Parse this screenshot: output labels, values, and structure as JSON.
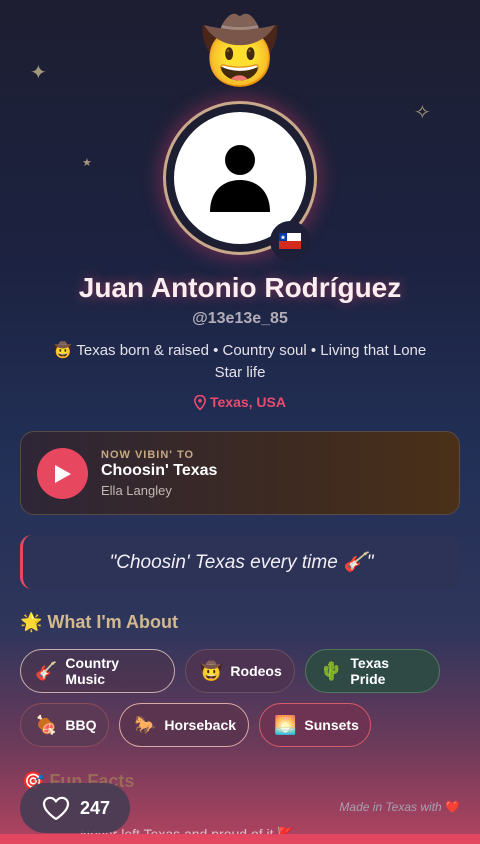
{
  "decor": {
    "sparkle_a": "✦",
    "sparkle_b": "✧",
    "sparkle_c": "★",
    "top_emoji": "🤠"
  },
  "profile": {
    "avatar_icon": "person-silhouette-icon",
    "flag": "🇨🇱",
    "name": "Juan Antonio Rodríguez",
    "handle": "@13e13e_85",
    "bio": "🤠 Texas born & raised • Country soul • Living that Lone Star life",
    "location": "Texas, USA"
  },
  "now_playing": {
    "label": "NOW VIBIN' TO",
    "song": "Choosin' Texas",
    "artist": "Ella Langley"
  },
  "quote": "\"Choosin' Texas every time 🎸\"",
  "about": {
    "title": "🌟 What I'm About",
    "tags": [
      {
        "icon": "🎸",
        "label": "Country Music"
      },
      {
        "icon": "🤠",
        "label": "Rodeos"
      },
      {
        "icon": "🌵",
        "label": "Texas Pride"
      },
      {
        "icon": "🍖",
        "label": "BBQ"
      },
      {
        "icon": "🐎",
        "label": "Horseback"
      },
      {
        "icon": "🌅",
        "label": "Sunsets"
      }
    ]
  },
  "fun_facts": {
    "title": "🎯 Fun Facts",
    "first": "Never left Texas and proud of it 🚩"
  },
  "footer": {
    "likes": "247",
    "made_in": "Made in Texas with",
    "heart": "❤️"
  },
  "colors": {
    "accent": "#e8485f",
    "gold": "#d2b98e"
  }
}
